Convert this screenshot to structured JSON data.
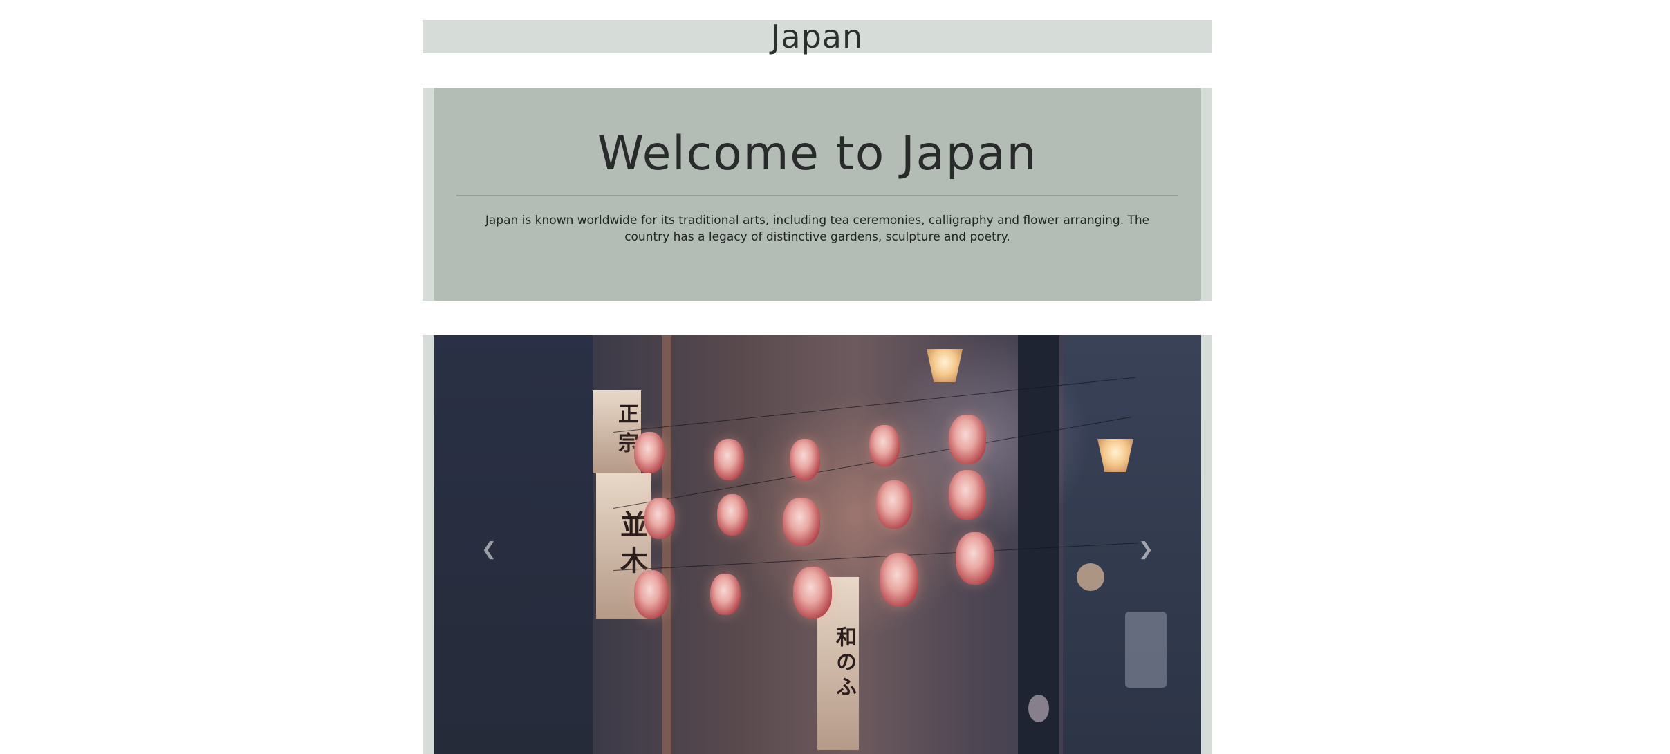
{
  "header": {
    "title": "Japan"
  },
  "intro": {
    "heading": "Welcome to Japan",
    "body": "Japan is known worldwide for its traditional arts, including tea ceremonies, calligraphy and flower arranging. The country has a legacy of distinctive gardens, sculpture and poetry."
  },
  "carousel": {
    "prev_icon": "chevron-left-icon",
    "next_icon": "chevron-right-icon",
    "prev_glyph": "❮",
    "next_glyph": "❯",
    "sign_text": "並木",
    "sign2_text": "正宗",
    "sign3_text": "和のふ"
  },
  "colors": {
    "header_bg": "#d6ddd8",
    "panel_bg": "#b4bdb5",
    "text": "#2b2f2e"
  }
}
